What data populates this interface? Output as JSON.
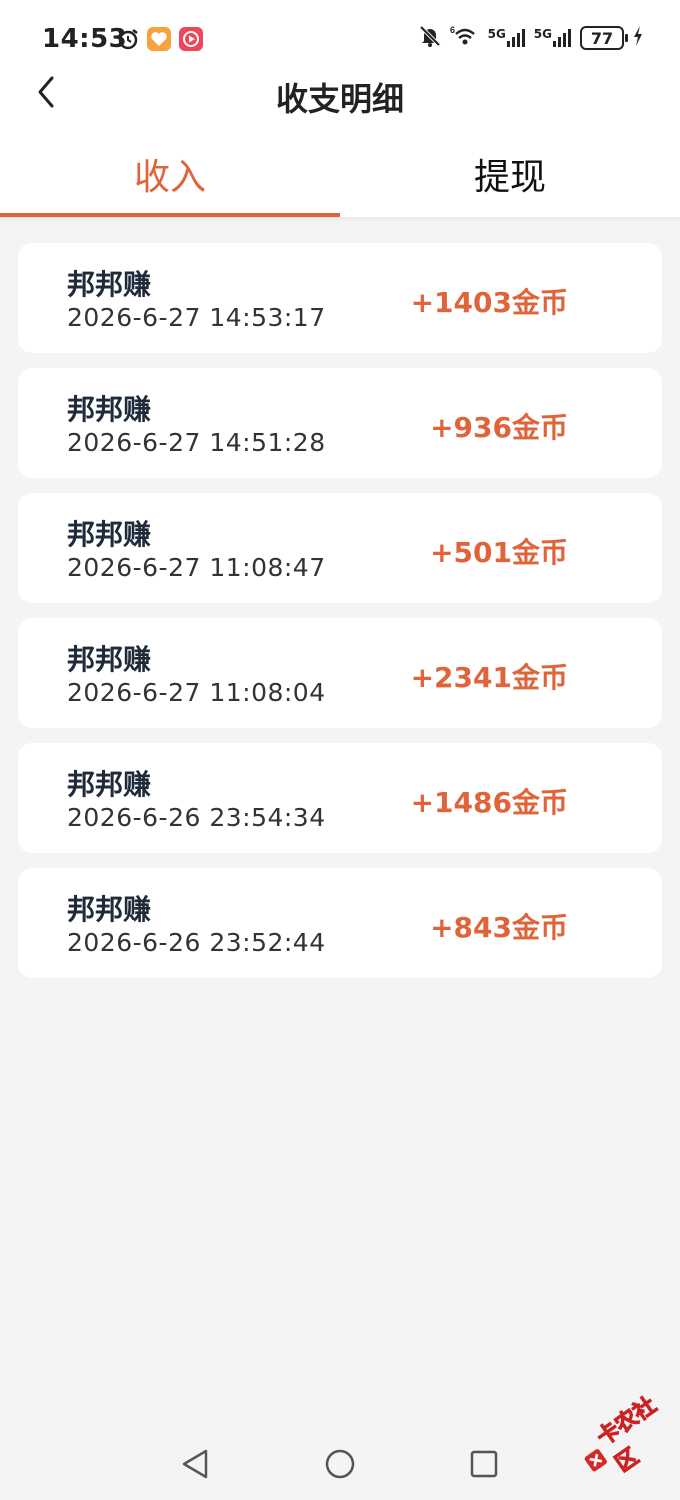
{
  "status_bar": {
    "time": "14:53",
    "signal1_label": "5G",
    "signal2_label": "5G",
    "wifi_label": "6",
    "battery": "77"
  },
  "header": {
    "title": "收支明细",
    "back_icon": "chevron-left-icon"
  },
  "tabs": [
    {
      "label": "收入",
      "active": true
    },
    {
      "label": "提现",
      "active": false
    }
  ],
  "records": [
    {
      "source": "邦邦赚",
      "time": "2026-6-27 14:53:17",
      "amount": "+1403金币"
    },
    {
      "source": "邦邦赚",
      "time": "2026-6-27 14:51:28",
      "amount": "+936金币"
    },
    {
      "source": "邦邦赚",
      "time": "2026-6-27 11:08:47",
      "amount": "+501金币"
    },
    {
      "source": "邦邦赚",
      "time": "2026-6-27 11:08:04",
      "amount": "+2341金币"
    },
    {
      "source": "邦邦赚",
      "time": "2026-6-26 23:54:34",
      "amount": "+1486金币"
    },
    {
      "source": "邦邦赚",
      "time": "2026-6-26 23:52:44",
      "amount": "+843金币"
    }
  ],
  "system_nav": [
    "back-triangle-icon",
    "home-circle-icon",
    "recents-square-icon"
  ],
  "watermark": "卡农社区",
  "colors": {
    "accent": "#e0643a",
    "background": "#f4f4f4",
    "card": "#ffffff"
  }
}
